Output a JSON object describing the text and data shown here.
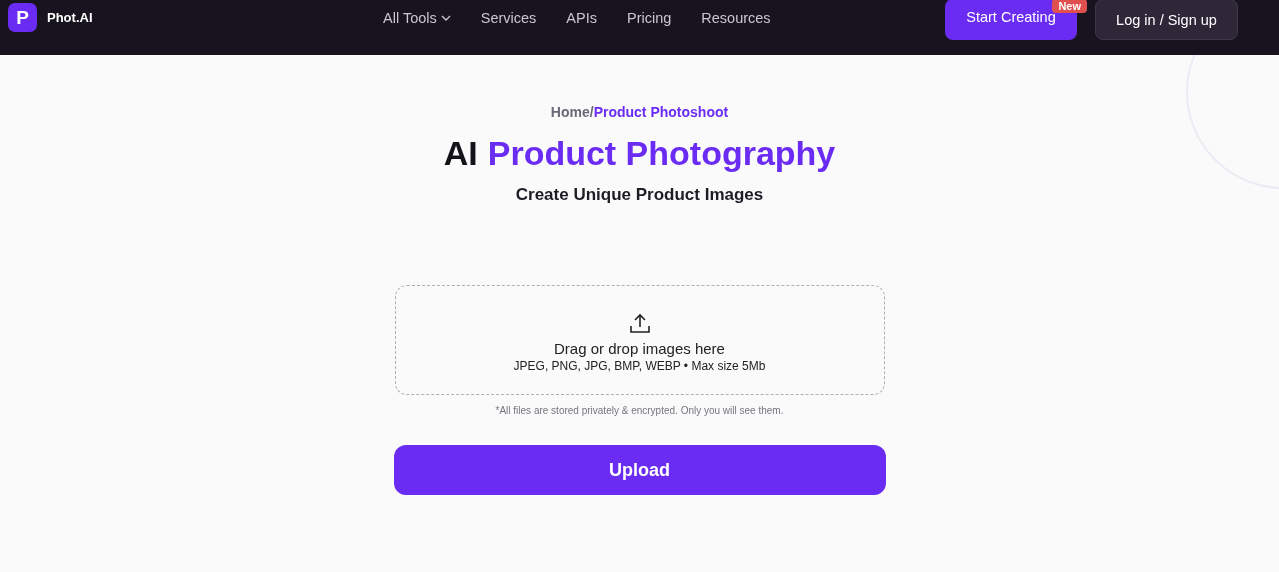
{
  "header": {
    "logo_letter": "P",
    "brand": "Phot.AI",
    "nav": [
      {
        "label": "All Tools",
        "has_menu": true
      },
      {
        "label": "Services",
        "has_menu": false
      },
      {
        "label": "APIs",
        "has_menu": false
      },
      {
        "label": "Pricing",
        "has_menu": false
      },
      {
        "label": "Resources",
        "has_menu": false
      }
    ],
    "start_button": "Start Creating",
    "badge": "New",
    "login_button": "Log in / Sign up"
  },
  "breadcrumb": {
    "home": "Home",
    "separator": "/",
    "current": "Product Photoshoot"
  },
  "title": {
    "plain": "AI",
    "accent": "Product Photography"
  },
  "subtitle": "Create Unique Product Images",
  "dropzone": {
    "title": "Drag or drop images here",
    "formats": "JPEG, PNG, JPG, BMP, WEBP • Max size 5Mb"
  },
  "privacy_note": "*All files are stored privately & encrypted. Only you will see them.",
  "upload_button": "Upload"
}
